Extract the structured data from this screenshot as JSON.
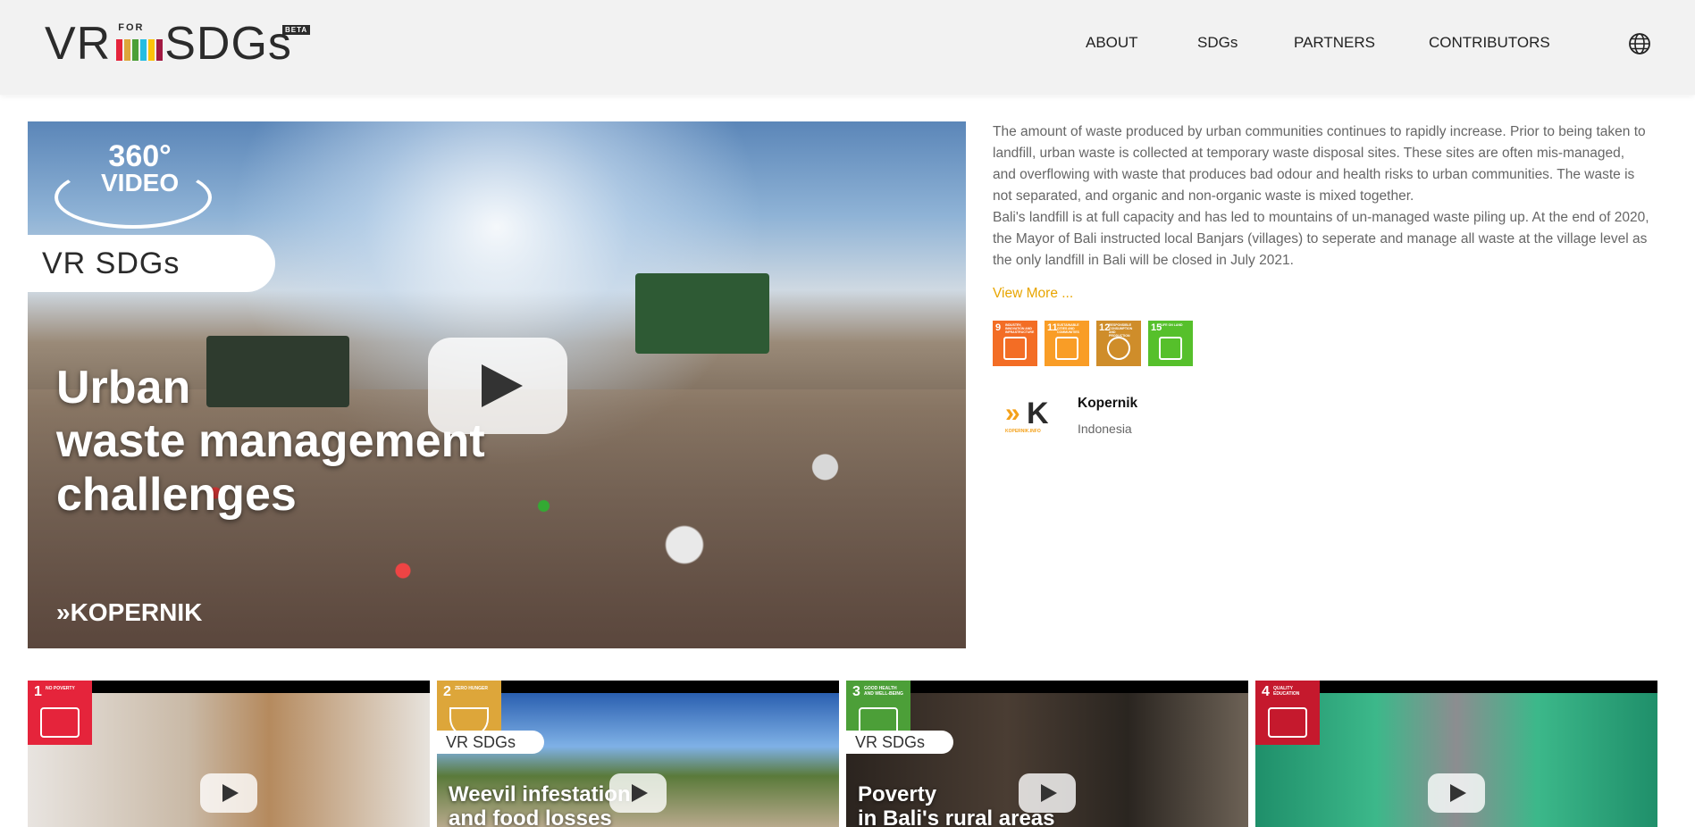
{
  "header": {
    "logo": {
      "left": "VR",
      "for": "FOR",
      "right": "SDGs",
      "beta": "BETA"
    },
    "nav": [
      {
        "label": "ABOUT"
      },
      {
        "label": "SDGs"
      },
      {
        "label": "PARTNERS"
      },
      {
        "label": "CONTRIBUTORS"
      }
    ],
    "globe_icon": "globe-icon"
  },
  "hero": {
    "badge_360_line1": "360°",
    "badge_360_line2": "VIDEO",
    "brand_badge": "VR SDGs",
    "title": "Urban\nwaste management\nchallenges",
    "partner_watermark": "»KOPERNIK",
    "play_icon": "play-icon"
  },
  "info": {
    "paragraphs": [
      "The amount of waste produced by urban communities continues to rapidly increase. Prior to being taken to landfill, urban waste is collected at temporary waste disposal sites. These sites are often mis-managed, and overflowing with waste that produces bad odour and health risks to urban communities. The waste is not separated, and organic and non-organic waste is mixed together.",
      "Bali's landfill is at full capacity and has led to mountains of un-managed waste piling up. At the end of 2020, the Mayor of Bali instructed local Banjars (villages) to seperate and manage all waste at the village level as the only landfill in Bali will be closed in July 2021."
    ],
    "view_more": "View More ...",
    "sdg_goals": [
      {
        "number": "9",
        "label": "Industry, innovation and infrastructure",
        "color": "#f36d25"
      },
      {
        "number": "11",
        "label": "Sustainable cities and communities",
        "color": "#f99d26"
      },
      {
        "number": "12",
        "label": "Responsible consumption and production",
        "color": "#cf8d2a"
      },
      {
        "number": "15",
        "label": "Life on land",
        "color": "#56c02b"
      }
    ],
    "partner": {
      "logo_text": "K",
      "logo_sub": "KOPERNIK.INFO",
      "name": "Kopernik",
      "country": "Indonesia"
    }
  },
  "thumbnails": [
    {
      "goal_number": "1",
      "goal_label": "No poverty",
      "goal_color": "#e5243b",
      "badge": "",
      "title": ""
    },
    {
      "goal_number": "2",
      "goal_label": "Zero hunger",
      "goal_color": "#dda63a",
      "badge": "VR SDGs",
      "title": "Weevil infestation\nand food losses"
    },
    {
      "goal_number": "3",
      "goal_label": "Good health and well-being",
      "goal_color": "#4c9f38",
      "badge": "VR SDGs",
      "title": "Poverty\nin Bali's rural areas"
    },
    {
      "goal_number": "4",
      "goal_label": "Quality education",
      "goal_color": "#c5192d",
      "badge": "",
      "title": ""
    }
  ]
}
